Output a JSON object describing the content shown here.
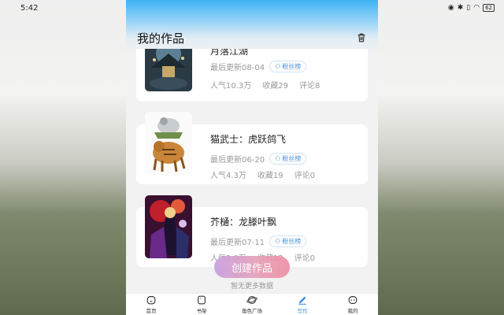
{
  "status_bar": {
    "time": "5:42",
    "battery": "62"
  },
  "header": {
    "title": "我的作品"
  },
  "works": [
    {
      "title": "月落江湖",
      "updated": "最后更新08-04",
      "badge": "粉丝榜",
      "popularity": "人气10.3万",
      "favorites": "收藏29",
      "comments": "评论8"
    },
    {
      "title": "猫武士：虎跃鸽飞",
      "updated": "最后更新06-20",
      "badge": "粉丝榜",
      "popularity": "人气4.3万",
      "favorites": "收藏19",
      "comments": "评论0"
    },
    {
      "title": "芥樋：龙滕叶飘",
      "updated": "最后更新07-11",
      "badge": "粉丝榜",
      "popularity": "人气2.0万",
      "favorites": "收藏12",
      "comments": "评论0"
    }
  ],
  "create_button": "创建作品",
  "no_more": "暂无更多数据",
  "tabs": [
    {
      "label": "首页",
      "icon": "home-icon"
    },
    {
      "label": "书架",
      "icon": "bookshelf-icon"
    },
    {
      "label": "角色广场",
      "icon": "planet-icon"
    },
    {
      "label": "写作",
      "icon": "pen-icon",
      "active": true
    },
    {
      "label": "我的",
      "icon": "profile-icon"
    }
  ],
  "colors": {
    "accent": "#3b8de0",
    "header_gradient": "#3fb2f5",
    "create_gradient_start": "#c89ee0",
    "create_gradient_end": "#ef8ea3"
  }
}
